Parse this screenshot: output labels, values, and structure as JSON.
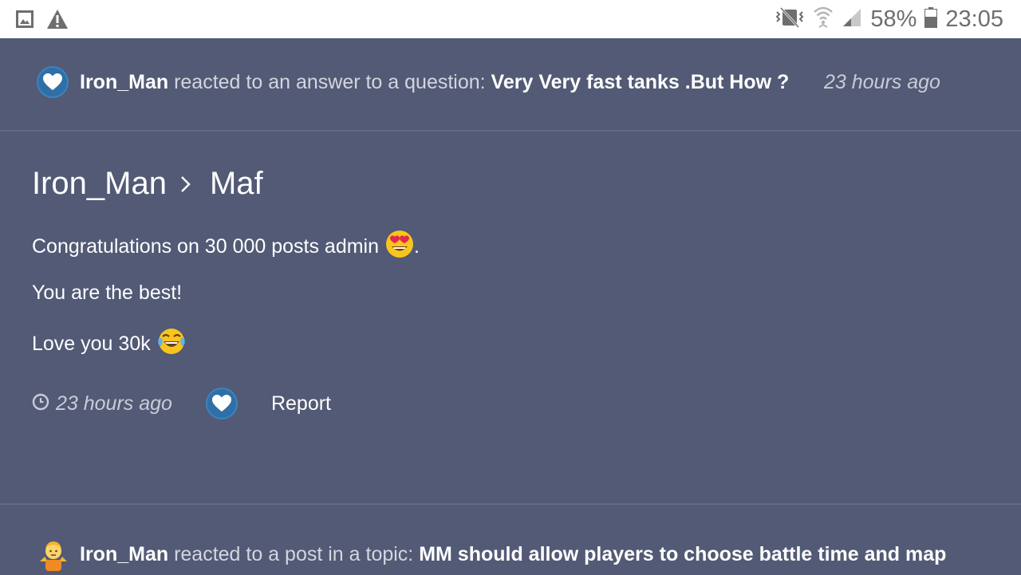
{
  "status_bar": {
    "battery_percent": "58%",
    "time": "23:05",
    "icons": [
      "gallery-icon",
      "warning-icon",
      "vibrate-icon",
      "wifi-icon",
      "signal-icon",
      "battery-icon"
    ]
  },
  "activities": [
    {
      "user": "Iron_Man",
      "action": " reacted to an answer to a question: ",
      "subject": "Very Very fast tanks .But How ?",
      "time": "23 hours ago",
      "reaction_icon": "heart-icon"
    },
    {
      "user": "Iron_Man",
      "action": " reacted to a post in a topic: ",
      "subject": "MM should allow players to choose battle time and map",
      "reaction_icon": "shrug-icon"
    }
  ],
  "post": {
    "author": "Iron_Man",
    "recipient": "Maf",
    "lines": [
      "Congratulations on 30 000 posts admin",
      ".",
      "You are the best!",
      "Love you 30k"
    ],
    "emoji_1": "heart-eyes-emoji",
    "emoji_2": "tears-of-joy-emoji",
    "time": "23 hours ago",
    "report_label": "Report"
  },
  "colors": {
    "background": "#525a75",
    "reaction_badge": "#2f6fa7",
    "text_primary": "#ffffff",
    "text_secondary": "#d3d6e0"
  }
}
